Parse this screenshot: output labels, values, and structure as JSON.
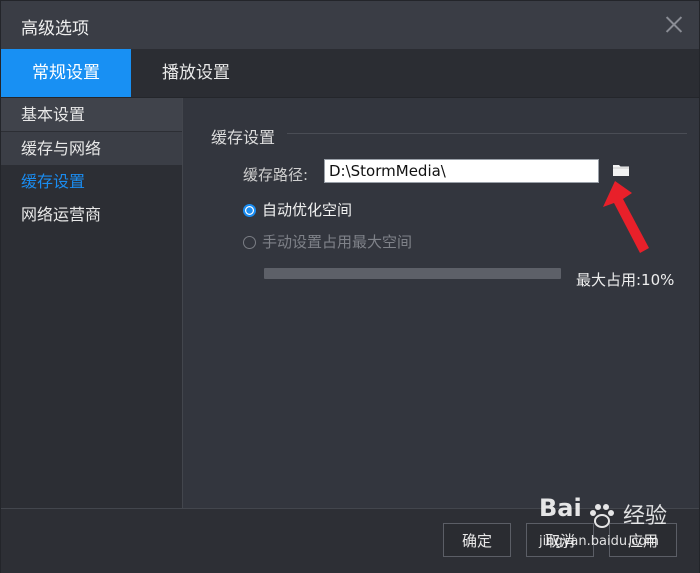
{
  "window": {
    "title": "高级选项"
  },
  "tabs": [
    {
      "label": "常规设置",
      "active": true
    },
    {
      "label": "播放设置",
      "active": false
    }
  ],
  "sidebar": {
    "items": [
      {
        "label": "基本设置"
      },
      {
        "label": "缓存与网络"
      },
      {
        "label": "缓存设置",
        "selected": true
      },
      {
        "label": "网络运营商"
      }
    ]
  },
  "cache": {
    "section_title": "缓存设置",
    "path_label": "缓存路径:",
    "path_value": "D:\\StormMedia\\",
    "auto_option": "自动优化空间",
    "manual_option": "手动设置占用最大空间",
    "selected_option": "auto",
    "max_label": "最大占用:10%",
    "max_percent": 10
  },
  "footer": {
    "ok_label": "确定",
    "cancel_label": "取消",
    "apply_label": "应用"
  },
  "watermark": {
    "brand": "Bai",
    "jingyan": "经验",
    "url": "jingyan.baidu.com"
  },
  "colors": {
    "accent": "#1890f3",
    "annotation_arrow": "#e8202a"
  }
}
